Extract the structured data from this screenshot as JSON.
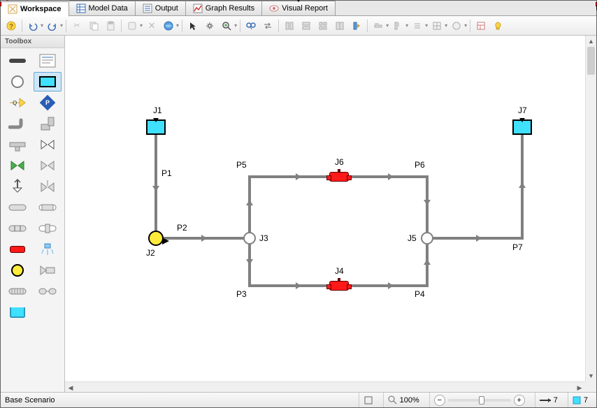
{
  "tabs": {
    "workspace": "Workspace",
    "model_data": "Model Data",
    "output": "Output",
    "graph_results": "Graph Results",
    "visual_report": "Visual Report"
  },
  "toolbox": {
    "title": "Toolbox"
  },
  "diagram": {
    "junctions": {
      "j1": "J1",
      "j2": "J2",
      "j3": "J3",
      "j4": "J4",
      "j5": "J5",
      "j6": "J6",
      "j7": "J7"
    },
    "pipes": {
      "p1": "P1",
      "p2": "P2",
      "p3": "P3",
      "p4": "P4",
      "p5": "P5",
      "p6": "P6",
      "p7": "P7"
    }
  },
  "status": {
    "scenario": "Base Scenario",
    "zoom": "100%",
    "pipe_count": "7",
    "junction_count": "7"
  }
}
